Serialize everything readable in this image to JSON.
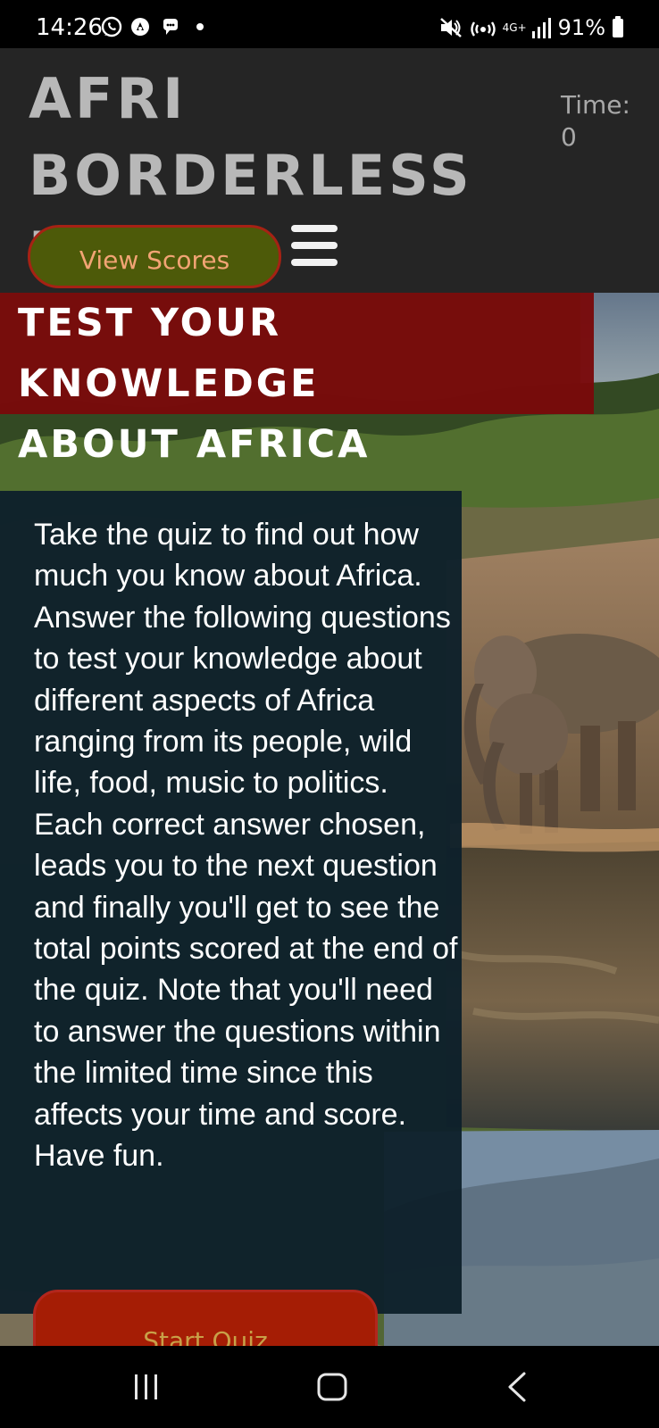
{
  "status_bar": {
    "time": "14:26",
    "battery": "91%",
    "network": "4G+"
  },
  "header": {
    "brand": "AFRI BORDERLESS MINDS",
    "timer_label": "Time:",
    "timer_value": "0",
    "view_scores_label": "View Scores"
  },
  "hero": {
    "title": "TEST YOUR KNOWLEDGE\nABOUT AFRICA",
    "description": "Take the quiz to find out how much you know about Africa. Answer the following questions to test your knowledge about different aspects of Africa ranging from its people, wild life, food, music to politics. Each correct answer chosen, leads you to the next question and finally you'll get to see the total points scored at the end of the quiz. Note that you'll need to answer the questions within the limited time since this affects your time and score. Have fun.",
    "start_quiz_label": "Start Quiz"
  },
  "colors": {
    "header_background": "#252525",
    "title_panel": "#79090a",
    "description_panel": "#0e202b",
    "view_scores_background": "#4d5a09",
    "start_quiz_background": "#a51d05"
  },
  "icons": {
    "whatsapp": "whatsapp-icon",
    "notification": "notification-icon",
    "chat": "chat-bubble-icon",
    "mute": "mute-icon",
    "hotspot": "hotspot-icon",
    "signal": "signal-icon",
    "menu": "hamburger-menu-icon",
    "recents": "recent-apps-icon",
    "home": "home-icon",
    "back": "back-icon"
  }
}
